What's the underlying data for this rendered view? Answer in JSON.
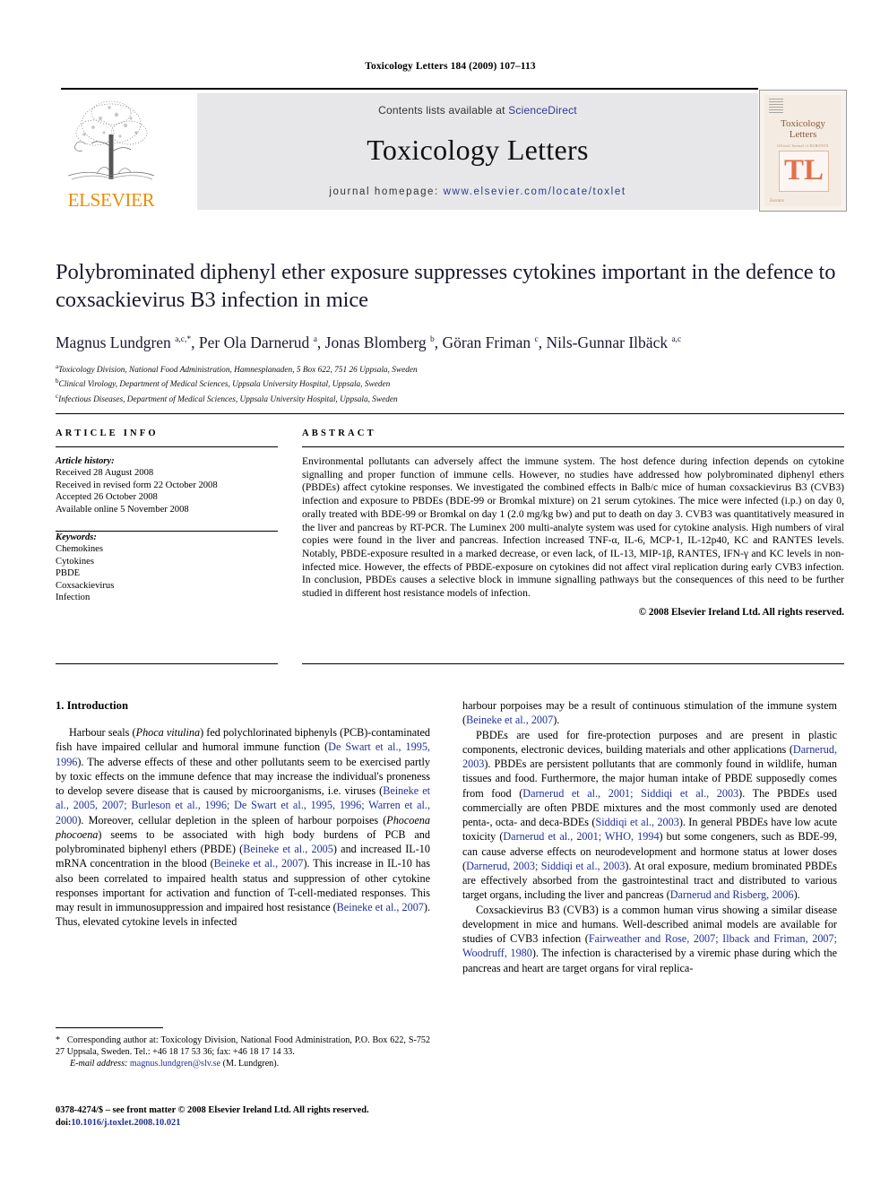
{
  "running_head": "Toxicology Letters 184 (2009) 107–113",
  "masthead": {
    "publisher_name": "ELSEVIER",
    "contents_prefix": "Contents lists available at ",
    "contents_link": "ScienceDirect",
    "journal_name": "Toxicology Letters",
    "homepage_prefix": "journal homepage: ",
    "homepage_url": "www.elsevier.com/locate/toxlet",
    "cover": {
      "title_line1": "Toxicology",
      "title_line2": "Letters",
      "subtitle": "Official Journal of EUROTOX",
      "monogram": "TL",
      "footer": "Eurotox"
    }
  },
  "article": {
    "title": "Polybrominated diphenyl ether exposure suppresses cytokines important in the defence to coxsackievirus B3 infection in mice",
    "authors_html": "Magnus Lundgren <sup>a,c,</sup><sup>*</sup>, Per Ola Darnerud <sup>a</sup>, Jonas Blomberg <sup>b</sup>, Göran Friman <sup>c</sup>, Nils-Gunnar Ilbäck <sup>a,c</sup>",
    "affiliations": [
      "Toxicology Division, National Food Administration, Hamnesplanaden, 5 Box 622, 751 26 Uppsala, Sweden",
      "Clinical Virology, Department of Medical Sciences, Uppsala University Hospital, Uppsala, Sweden",
      "Infectious Diseases, Department of Medical Sciences, Uppsala University Hospital, Uppsala, Sweden"
    ],
    "affiliation_marks": [
      "a",
      "b",
      "c"
    ]
  },
  "article_info": {
    "heading": "ARTICLE INFO",
    "history_label": "Article history:",
    "history": [
      "Received 28 August 2008",
      "Received in revised form 22 October 2008",
      "Accepted 26 October 2008",
      "Available online 5 November 2008"
    ],
    "keywords_label": "Keywords:",
    "keywords": [
      "Chemokines",
      "Cytokines",
      "PBDE",
      "Coxsackievirus",
      "Infection"
    ]
  },
  "abstract": {
    "heading": "ABSTRACT",
    "text": "Environmental pollutants can adversely affect the immune system. The host defence during infection depends on cytokine signalling and proper function of immune cells. However, no studies have addressed how polybrominated diphenyl ethers (PBDEs) affect cytokine responses. We investigated the combined effects in Balb/c mice of human coxsackievirus B3 (CVB3) infection and exposure to PBDEs (BDE-99 or Bromkal mixture) on 21 serum cytokines. The mice were infected (i.p.) on day 0, orally treated with BDE-99 or Bromkal on day 1 (2.0 mg/kg bw) and put to death on day 3. CVB3 was quantitatively measured in the liver and pancreas by RT-PCR. The Luminex 200 multi-analyte system was used for cytokine analysis. High numbers of viral copies were found in the liver and pancreas. Infection increased TNF-α, IL-6, MCP-1, IL-12p40, KC and RANTES levels. Notably, PBDE-exposure resulted in a marked decrease, or even lack, of IL-13, MIP-1β, RANTES, IFN-γ and KC levels in non-infected mice. However, the effects of PBDE-exposure on cytokines did not affect viral replication during early CVB3 infection. In conclusion, PBDEs causes a selective block in immune signalling pathways but the consequences of this need to be further studied in different host resistance models of infection.",
    "copyright": "© 2008 Elsevier Ireland Ltd. All rights reserved."
  },
  "introduction": {
    "heading": "1. Introduction",
    "left_paragraph_html": "Harbour seals (<span class=\"it\">Phoca vitulina</span>) fed polychlorinated biphenyls (PCB)-contaminated fish have impaired cellular and humoral immune function (<span class=\"ref\">De Swart et al., 1995, 1996</span>). The adverse effects of these and other pollutants seem to be exercised partly by toxic effects on the immune defence that may increase the individual's proneness to develop severe disease that is caused by microorganisms, i.e. viruses (<span class=\"ref\">Beineke et al., 2005, 2007; Burleson et al., 1996; De Swart et al., 1995, 1996; Warren et al., 2000</span>). Moreover, cellular depletion in the spleen of harbour porpoises (<span class=\"it\">Phocoena phocoena</span>) seems to be associated with high body burdens of PCB and polybrominated biphenyl ethers (PBDE) (<span class=\"ref\">Beineke et al., 2005</span>) and increased IL-10 mRNA concentration in the blood (<span class=\"ref\">Beineke et al., 2007</span>). This increase in IL-10 has also been correlated to impaired health status and suppression of other cytokine responses important for activation and function of T-cell-mediated responses. This may result in immunosuppression and impaired host resistance (<span class=\"ref\">Beineke et al., 2007</span>). Thus, elevated cytokine levels in infected",
    "right_paragraph_1_html": "harbour porpoises may be a result of continuous stimulation of the immune system (<span class=\"ref\">Beineke et al., 2007</span>).",
    "right_paragraph_2_html": "PBDEs are used for fire-protection purposes and are present in plastic components, electronic devices, building materials and other applications (<span class=\"ref\">Darnerud, 2003</span>). PBDEs are persistent pollutants that are commonly found in wildlife, human tissues and food. Furthermore, the major human intake of PBDE supposedly comes from food (<span class=\"ref\">Darnerud et al., 2001; Siddiqi et al., 2003</span>). The PBDEs used commercially are often PBDE mixtures and the most commonly used are denoted penta-, octa- and deca-BDEs (<span class=\"ref\">Siddiqi et al., 2003</span>). In general PBDEs have low acute toxicity (<span class=\"ref\">Darnerud et al., 2001; WHO, 1994</span>) but some congeners, such as BDE-99, can cause adverse effects on neurodevelopment and hormone status at lower doses (<span class=\"ref\">Darnerud, 2003; Siddiqi et al., 2003</span>). At oral exposure, medium brominated PBDEs are effectively absorbed from the gastrointestinal tract and distributed to various target organs, including the liver and pancreas (<span class=\"ref\">Darnerud and Risberg, 2006</span>).",
    "right_paragraph_3_html": "Coxsackievirus B3 (CVB3) is a common human virus showing a similar disease development in mice and humans. Well-described animal models are available for studies of CVB3 infection (<span class=\"ref\">Fairweather and Rose, 2007; Ilback and Friman, 2007; Woodruff, 1980</span>). The infection is characterised by a viremic phase during which the pancreas and heart are target organs for viral replica-"
  },
  "footnote": {
    "corresponding_html": "<span class=\"star\">*</span>&nbsp; Corresponding author at: Toxicology Division, National Food Administration, P.O. Box 622, S-752 27 Uppsala, Sweden. Tel.: +46 18 17 53 36; fax: +46 18 17 14 33.",
    "email_label": "E-mail address:",
    "email": "magnus.lundgren@slv.se",
    "email_owner": "(M. Lundgren)."
  },
  "imprint": {
    "issn_line": "0378-4274/$ – see front matter © 2008 Elsevier Ireland Ltd. All rights reserved.",
    "doi_label": "doi:",
    "doi": "10.1016/j.toxlet.2008.10.021"
  },
  "colors": {
    "link_blue": "#21319c",
    "banner_grey": "#e7e7e9",
    "elsevier_orange": "#ED8B00",
    "cover_orange": "#e2704a"
  }
}
